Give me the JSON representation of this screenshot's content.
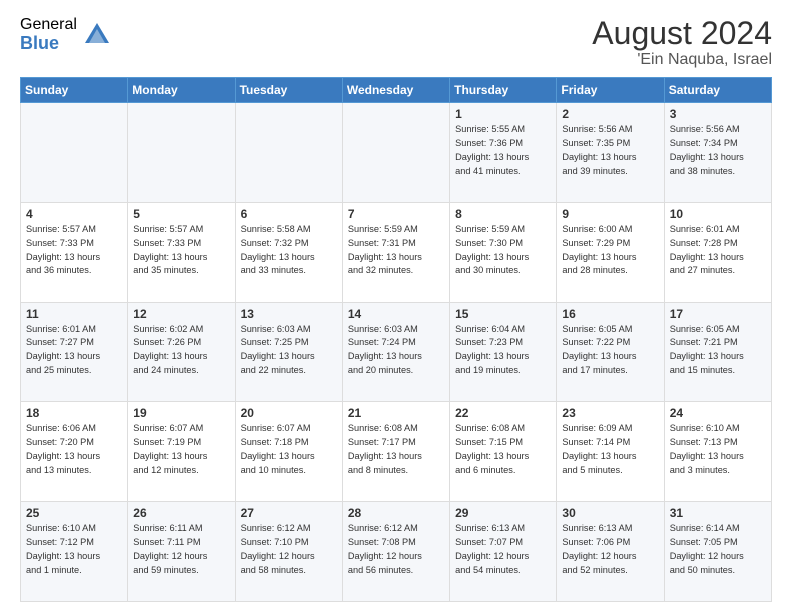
{
  "logo": {
    "general": "General",
    "blue": "Blue"
  },
  "header": {
    "month": "August 2024",
    "location": "'Ein Naquba, Israel"
  },
  "weekdays": [
    "Sunday",
    "Monday",
    "Tuesday",
    "Wednesday",
    "Thursday",
    "Friday",
    "Saturday"
  ],
  "weeks": [
    [
      {
        "day": "",
        "info": ""
      },
      {
        "day": "",
        "info": ""
      },
      {
        "day": "",
        "info": ""
      },
      {
        "day": "",
        "info": ""
      },
      {
        "day": "1",
        "info": "Sunrise: 5:55 AM\nSunset: 7:36 PM\nDaylight: 13 hours\nand 41 minutes."
      },
      {
        "day": "2",
        "info": "Sunrise: 5:56 AM\nSunset: 7:35 PM\nDaylight: 13 hours\nand 39 minutes."
      },
      {
        "day": "3",
        "info": "Sunrise: 5:56 AM\nSunset: 7:34 PM\nDaylight: 13 hours\nand 38 minutes."
      }
    ],
    [
      {
        "day": "4",
        "info": "Sunrise: 5:57 AM\nSunset: 7:33 PM\nDaylight: 13 hours\nand 36 minutes."
      },
      {
        "day": "5",
        "info": "Sunrise: 5:57 AM\nSunset: 7:33 PM\nDaylight: 13 hours\nand 35 minutes."
      },
      {
        "day": "6",
        "info": "Sunrise: 5:58 AM\nSunset: 7:32 PM\nDaylight: 13 hours\nand 33 minutes."
      },
      {
        "day": "7",
        "info": "Sunrise: 5:59 AM\nSunset: 7:31 PM\nDaylight: 13 hours\nand 32 minutes."
      },
      {
        "day": "8",
        "info": "Sunrise: 5:59 AM\nSunset: 7:30 PM\nDaylight: 13 hours\nand 30 minutes."
      },
      {
        "day": "9",
        "info": "Sunrise: 6:00 AM\nSunset: 7:29 PM\nDaylight: 13 hours\nand 28 minutes."
      },
      {
        "day": "10",
        "info": "Sunrise: 6:01 AM\nSunset: 7:28 PM\nDaylight: 13 hours\nand 27 minutes."
      }
    ],
    [
      {
        "day": "11",
        "info": "Sunrise: 6:01 AM\nSunset: 7:27 PM\nDaylight: 13 hours\nand 25 minutes."
      },
      {
        "day": "12",
        "info": "Sunrise: 6:02 AM\nSunset: 7:26 PM\nDaylight: 13 hours\nand 24 minutes."
      },
      {
        "day": "13",
        "info": "Sunrise: 6:03 AM\nSunset: 7:25 PM\nDaylight: 13 hours\nand 22 minutes."
      },
      {
        "day": "14",
        "info": "Sunrise: 6:03 AM\nSunset: 7:24 PM\nDaylight: 13 hours\nand 20 minutes."
      },
      {
        "day": "15",
        "info": "Sunrise: 6:04 AM\nSunset: 7:23 PM\nDaylight: 13 hours\nand 19 minutes."
      },
      {
        "day": "16",
        "info": "Sunrise: 6:05 AM\nSunset: 7:22 PM\nDaylight: 13 hours\nand 17 minutes."
      },
      {
        "day": "17",
        "info": "Sunrise: 6:05 AM\nSunset: 7:21 PM\nDaylight: 13 hours\nand 15 minutes."
      }
    ],
    [
      {
        "day": "18",
        "info": "Sunrise: 6:06 AM\nSunset: 7:20 PM\nDaylight: 13 hours\nand 13 minutes."
      },
      {
        "day": "19",
        "info": "Sunrise: 6:07 AM\nSunset: 7:19 PM\nDaylight: 13 hours\nand 12 minutes."
      },
      {
        "day": "20",
        "info": "Sunrise: 6:07 AM\nSunset: 7:18 PM\nDaylight: 13 hours\nand 10 minutes."
      },
      {
        "day": "21",
        "info": "Sunrise: 6:08 AM\nSunset: 7:17 PM\nDaylight: 13 hours\nand 8 minutes."
      },
      {
        "day": "22",
        "info": "Sunrise: 6:08 AM\nSunset: 7:15 PM\nDaylight: 13 hours\nand 6 minutes."
      },
      {
        "day": "23",
        "info": "Sunrise: 6:09 AM\nSunset: 7:14 PM\nDaylight: 13 hours\nand 5 minutes."
      },
      {
        "day": "24",
        "info": "Sunrise: 6:10 AM\nSunset: 7:13 PM\nDaylight: 13 hours\nand 3 minutes."
      }
    ],
    [
      {
        "day": "25",
        "info": "Sunrise: 6:10 AM\nSunset: 7:12 PM\nDaylight: 13 hours\nand 1 minute."
      },
      {
        "day": "26",
        "info": "Sunrise: 6:11 AM\nSunset: 7:11 PM\nDaylight: 12 hours\nand 59 minutes."
      },
      {
        "day": "27",
        "info": "Sunrise: 6:12 AM\nSunset: 7:10 PM\nDaylight: 12 hours\nand 58 minutes."
      },
      {
        "day": "28",
        "info": "Sunrise: 6:12 AM\nSunset: 7:08 PM\nDaylight: 12 hours\nand 56 minutes."
      },
      {
        "day": "29",
        "info": "Sunrise: 6:13 AM\nSunset: 7:07 PM\nDaylight: 12 hours\nand 54 minutes."
      },
      {
        "day": "30",
        "info": "Sunrise: 6:13 AM\nSunset: 7:06 PM\nDaylight: 12 hours\nand 52 minutes."
      },
      {
        "day": "31",
        "info": "Sunrise: 6:14 AM\nSunset: 7:05 PM\nDaylight: 12 hours\nand 50 minutes."
      }
    ]
  ]
}
